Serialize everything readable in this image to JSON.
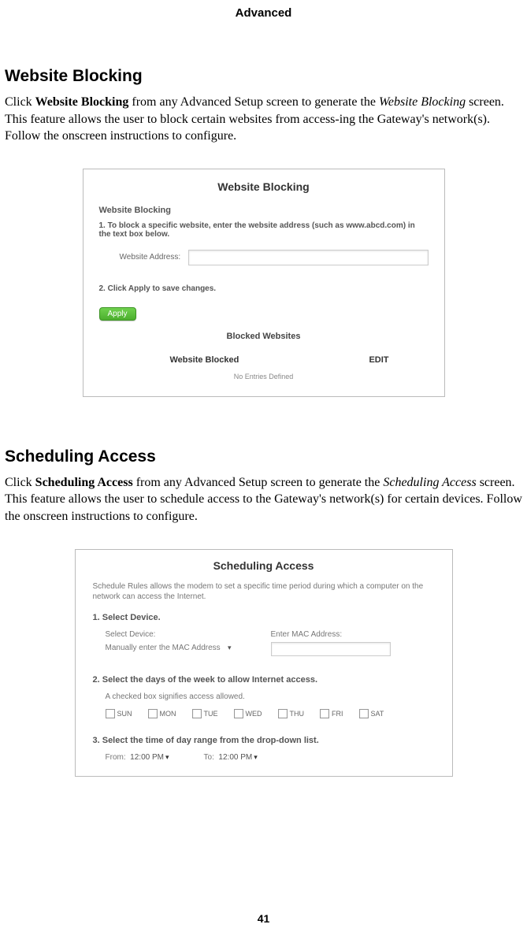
{
  "chapter": "Advanced",
  "page_number": "41",
  "section1": {
    "title": "Website Blocking",
    "intro_pre": "Click ",
    "intro_bold": "Website Blocking",
    "intro_mid": " from any Advanced Setup screen to generate the ",
    "intro_ital": "Website Blocking",
    "intro_post": " screen. This feature allows the user to block certain websites from access-ing the Gateway's network(s). Follow the onscreen instructions to configure."
  },
  "shot1": {
    "title": "Website Blocking",
    "sub": "Website Blocking",
    "step1": "1. To block a specific website, enter the website address (such as www.abcd.com) in the text box below.",
    "address_label": "Website Address:",
    "step2": "2. Click Apply to save changes.",
    "apply": "Apply",
    "bw_title": "Blocked Websites",
    "col1": "Website Blocked",
    "col2": "EDIT",
    "empty": "No Entries Defined"
  },
  "section2": {
    "title": "Scheduling Access",
    "intro_pre": "Click ",
    "intro_bold": "Scheduling Access",
    "intro_mid": " from any Advanced Setup screen to generate the ",
    "intro_ital": "Scheduling Access",
    "intro_post": " screen. This feature allows the user to schedule access to the Gateway's network(s) for certain devices. Follow the onscreen instructions to configure."
  },
  "shot2": {
    "title": "Scheduling Access",
    "desc": "Schedule Rules allows the modem to set a specific time period during which a computer on the network can access the Internet.",
    "step1": "1. Select Device.",
    "select_device_label": "Select Device:",
    "select_device_value": "Manually enter the MAC Address",
    "mac_label": "Enter MAC Address:",
    "step2": "2. Select the days of the week to allow Internet access.",
    "note": "A checked box signifies access allowed.",
    "days": [
      "SUN",
      "MON",
      "TUE",
      "WED",
      "THU",
      "FRI",
      "SAT"
    ],
    "step3": "3. Select the time of day range from the drop-down list.",
    "from_label": "From:",
    "from_value": "12:00 PM",
    "to_label": "To:",
    "to_value": "12:00 PM"
  }
}
